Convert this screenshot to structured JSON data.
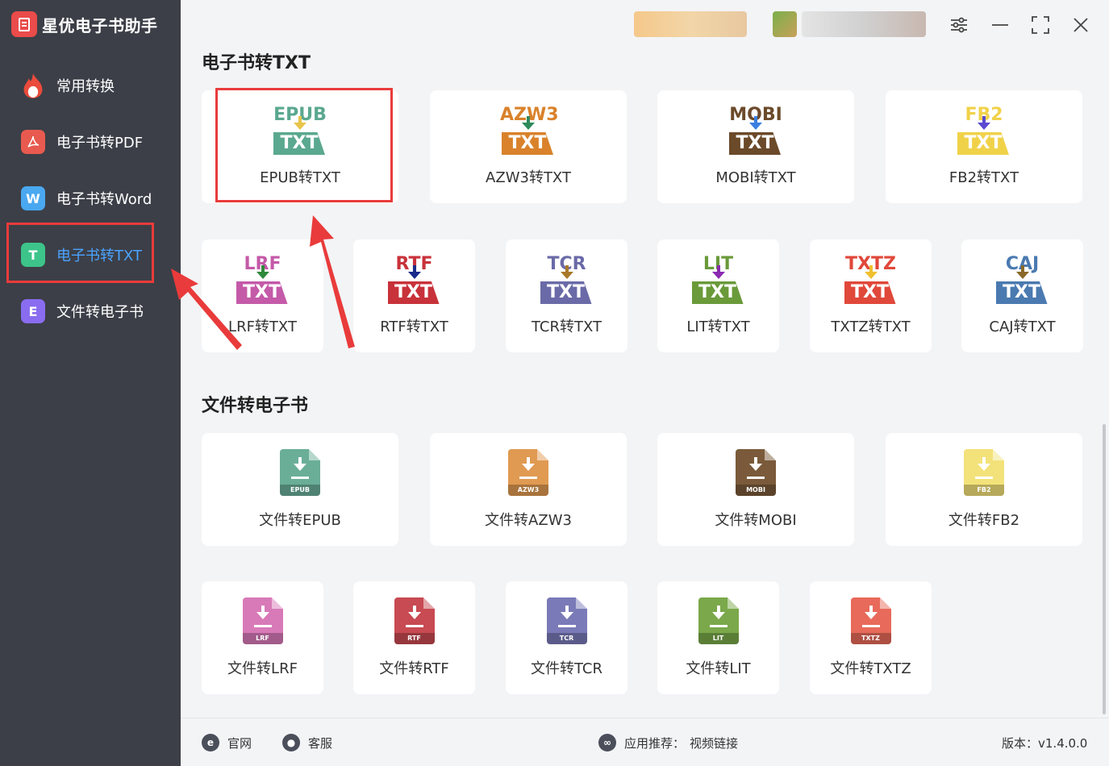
{
  "app": {
    "name": "星优电子书助手"
  },
  "sidebar": {
    "items": [
      {
        "label": "常用转换",
        "icon": "fire-icon",
        "color": "#e94b3c"
      },
      {
        "label": "电子书转PDF",
        "icon": "pdf-icon",
        "color": "#e85a4f"
      },
      {
        "label": "电子书转Word",
        "icon": "word-icon",
        "color": "#4aa8f0"
      },
      {
        "label": "电子书转TXT",
        "icon": "txt-icon",
        "color": "#3dc48a",
        "active": true
      },
      {
        "label": "文件转电子书",
        "icon": "ebook-icon",
        "color": "#8a6cf0"
      }
    ]
  },
  "main": {
    "section1": {
      "title": "电子书转TXT",
      "cards": [
        {
          "label": "EPUB转TXT",
          "fmt": "EPUB",
          "fmtColor": "#5aa88f",
          "arrowColor": "#e8c44a",
          "txtColor": "#5aa88f"
        },
        {
          "label": "AZW3转TXT",
          "fmt": "AZW3",
          "fmtColor": "#d9822b",
          "arrowColor": "#2f8a5a",
          "txtColor": "#d9822b"
        },
        {
          "label": "MOBI转TXT",
          "fmt": "MOBI",
          "fmtColor": "#6b4a2a",
          "arrowColor": "#3a7fe0",
          "txtColor": "#6b4a2a"
        },
        {
          "label": "FB2转TXT",
          "fmt": "FB2",
          "fmtColor": "#f0d24a",
          "arrowColor": "#5a4ad0",
          "txtColor": "#f0d24a"
        },
        {
          "label": "LRF转TXT",
          "fmt": "LRF",
          "fmtColor": "#c45aa8",
          "arrowColor": "#2f8a3a",
          "txtColor": "#c45aa8"
        },
        {
          "label": "RTF转TXT",
          "fmt": "RTF",
          "fmtColor": "#c8323a",
          "arrowColor": "#1a2a8a",
          "txtColor": "#c8323a"
        },
        {
          "label": "TCR转TXT",
          "fmt": "TCR",
          "fmtColor": "#6a6aa8",
          "arrowColor": "#a8782a",
          "txtColor": "#6a6aa8"
        },
        {
          "label": "LIT转TXT",
          "fmt": "LIT",
          "fmtColor": "#6a9a3a",
          "arrowColor": "#8a2ab0",
          "txtColor": "#6a9a3a"
        },
        {
          "label": "TXTZ转TXT",
          "fmt": "TXTZ",
          "fmtColor": "#e0483a",
          "arrowColor": "#f0c030",
          "txtColor": "#e0483a"
        },
        {
          "label": "CAJ转TXT",
          "fmt": "CAJ",
          "fmtColor": "#4a7ab0",
          "arrowColor": "#8a6a2a",
          "txtColor": "#4a7ab0"
        }
      ]
    },
    "section2": {
      "title": "文件转电子书",
      "cards": [
        {
          "label": "文件转EPUB",
          "tag": "EPUB",
          "color": "#6aae98"
        },
        {
          "label": "文件转AZW3",
          "tag": "AZW3",
          "color": "#e09a52"
        },
        {
          "label": "文件转MOBI",
          "tag": "MOBI",
          "color": "#7a5a3a"
        },
        {
          "label": "文件转FB2",
          "tag": "FB2",
          "color": "#f3e27a"
        },
        {
          "label": "文件转LRF",
          "tag": "LRF",
          "color": "#d87ab8"
        },
        {
          "label": "文件转RTF",
          "tag": "RTF",
          "color": "#c84a52"
        },
        {
          "label": "文件转TCR",
          "tag": "TCR",
          "color": "#7a7ab8"
        },
        {
          "label": "文件转LIT",
          "tag": "LIT",
          "color": "#7aa84a"
        },
        {
          "label": "文件转TXTZ",
          "tag": "TXTZ",
          "color": "#e86a5a"
        }
      ]
    }
  },
  "footer": {
    "website": "官网",
    "service": "客服",
    "recommend_label": "应用推荐：",
    "recommend_link": "视频链接",
    "version": "版本：v1.4.0.0"
  },
  "colors": {
    "highlight": "#e93b3b",
    "active": "#4aa3ff",
    "sidebar_bg": "#3c3f47"
  }
}
